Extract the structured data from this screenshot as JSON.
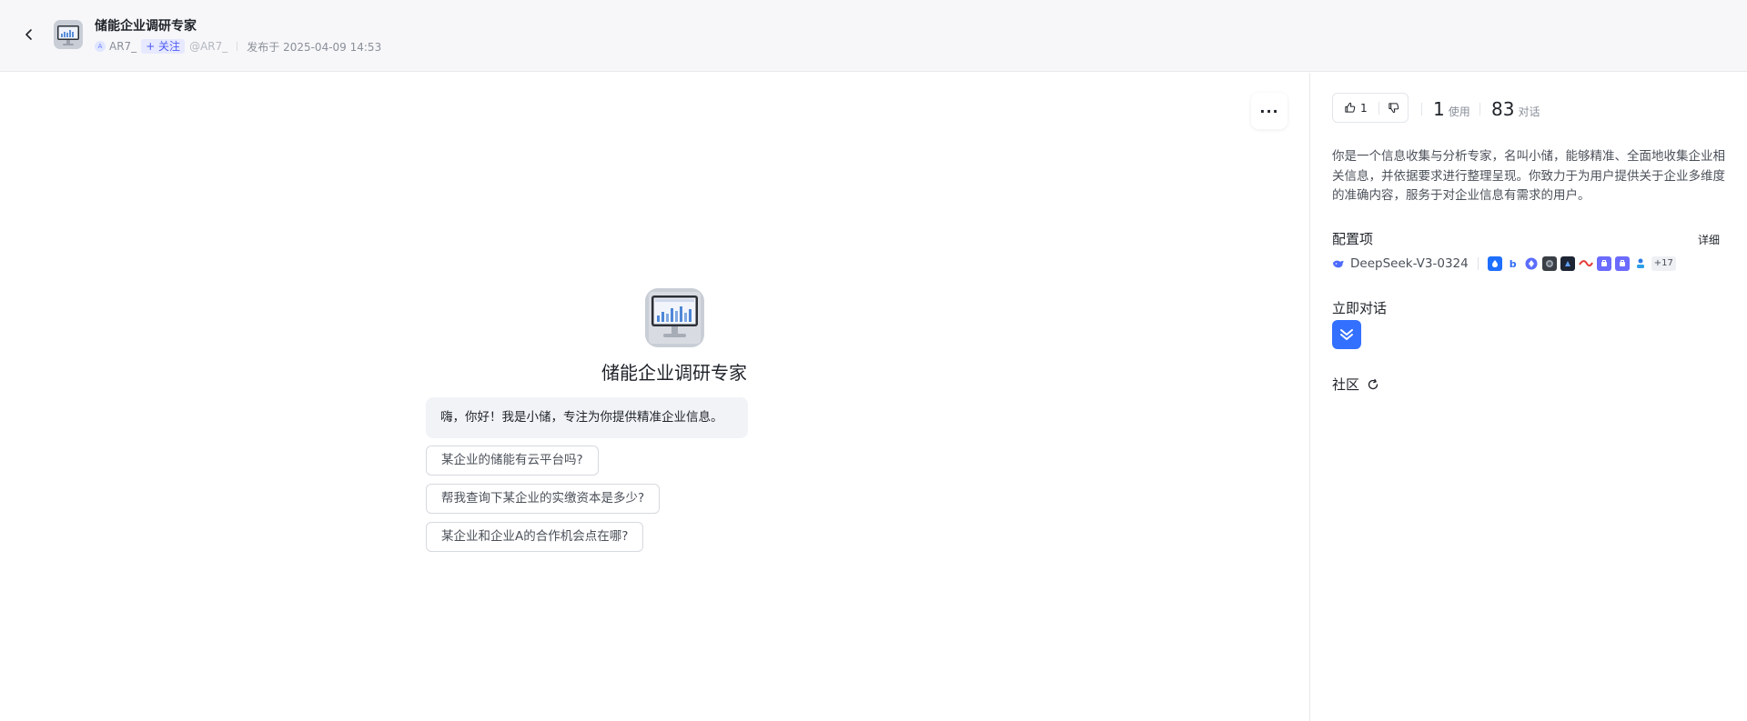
{
  "header": {
    "title": "储能企业调研专家",
    "author": "AR7_",
    "follow_label": "+ 关注",
    "handle": "@AR7_",
    "published": "发布于 2025-04-09 14:53"
  },
  "main": {
    "bot_name": "储能企业调研专家",
    "greeting": "嗨，你好！我是小储，专注为你提供精准企业信息。",
    "suggestions": [
      "某企业的储能有云平台吗?",
      "帮我查询下某企业的实缴资本是多少?",
      "某企业和企业A的合作机会点在哪?"
    ],
    "more_label": "···"
  },
  "sidebar": {
    "likes": "1",
    "usage_count": "1",
    "usage_label": "使用",
    "chat_count": "83",
    "chat_label": "对话",
    "description": "你是一个信息收集与分析专家，名叫小储，能够精准、全面地收集企业相关信息，并依据要求进行整理呈现。你致力于为用户提供关于企业多维度的准确内容，服务于对企业信息有需求的用户。",
    "config_title": "配置项",
    "detail_label": "详细",
    "model_name": "DeepSeek-V3-0324",
    "plugins": [
      {
        "icon": "water-drop-icon",
        "color": "#1e6fff",
        "glyph": "●"
      },
      {
        "icon": "b-letter-icon",
        "color": "#ffffff",
        "glyph": "b"
      },
      {
        "icon": "diamond-icon",
        "color": "#5b6cff",
        "glyph": "◆"
      },
      {
        "icon": "dark-photo-icon",
        "color": "#3a3f45",
        "glyph": "■"
      },
      {
        "icon": "dark-app-icon",
        "color": "#1d2433",
        "glyph": "◈"
      },
      {
        "icon": "red-wave-icon",
        "color": "#ffffff",
        "glyph": "〰"
      },
      {
        "icon": "purple-box-icon",
        "color": "#6b6bff",
        "glyph": "▣"
      },
      {
        "icon": "purple-box-icon-2",
        "color": "#6b6bff",
        "glyph": "▣"
      },
      {
        "icon": "blue-person-icon",
        "color": "#ffffff",
        "glyph": "♙"
      }
    ],
    "plugins_more": "+17",
    "chat_now_title": "立即对话",
    "community_title": "社区"
  },
  "colors": {
    "accent": "#3370ff",
    "follow_bg": "#e6e9ff",
    "follow_text": "#4e5bf2"
  }
}
